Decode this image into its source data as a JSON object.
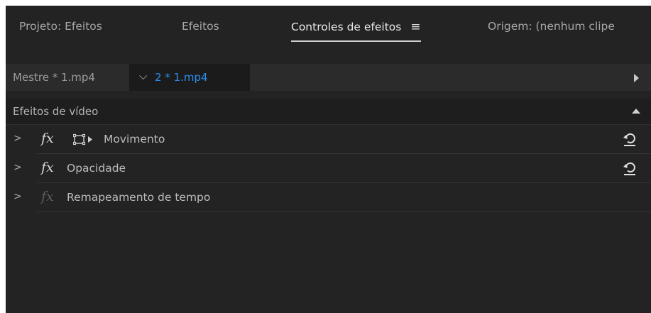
{
  "tabs": [
    {
      "label": "Projeto: Efeitos",
      "active": false
    },
    {
      "label": "Efeitos",
      "active": false
    },
    {
      "label": "Controles de efeitos",
      "active": true
    },
    {
      "label": "Origem: (nenhum clipe",
      "active": false
    }
  ],
  "clip_row": {
    "master_clip": "Mestre * 1.mp4",
    "sequence_clip": "2 * 1.mp4"
  },
  "section": {
    "title": "Efeitos de vídeo"
  },
  "effects": [
    {
      "fx_symbol": "fx",
      "name": "Movimento",
      "has_transform_icon": true,
      "has_reset": true,
      "enabled": true
    },
    {
      "fx_symbol": "fx",
      "name": "Opacidade",
      "has_transform_icon": false,
      "has_reset": true,
      "enabled": true
    },
    {
      "fx_symbol": "fx",
      "name": "Remapeamento de tempo",
      "has_transform_icon": false,
      "has_reset": false,
      "enabled": false
    }
  ],
  "icons": {
    "panel_menu": "hamburger-menu-icon",
    "clip_dropdown": "chevron-down-icon",
    "expand": "chevron-right-icon",
    "reset": "reset-parameter-icon",
    "transform": "transform-handles-icon"
  },
  "colors": {
    "panel_bg": "#232323",
    "accent_blue": "#2d8ceb",
    "text_primary": "#e9e9e9",
    "text_secondary": "#a7a7a7"
  }
}
